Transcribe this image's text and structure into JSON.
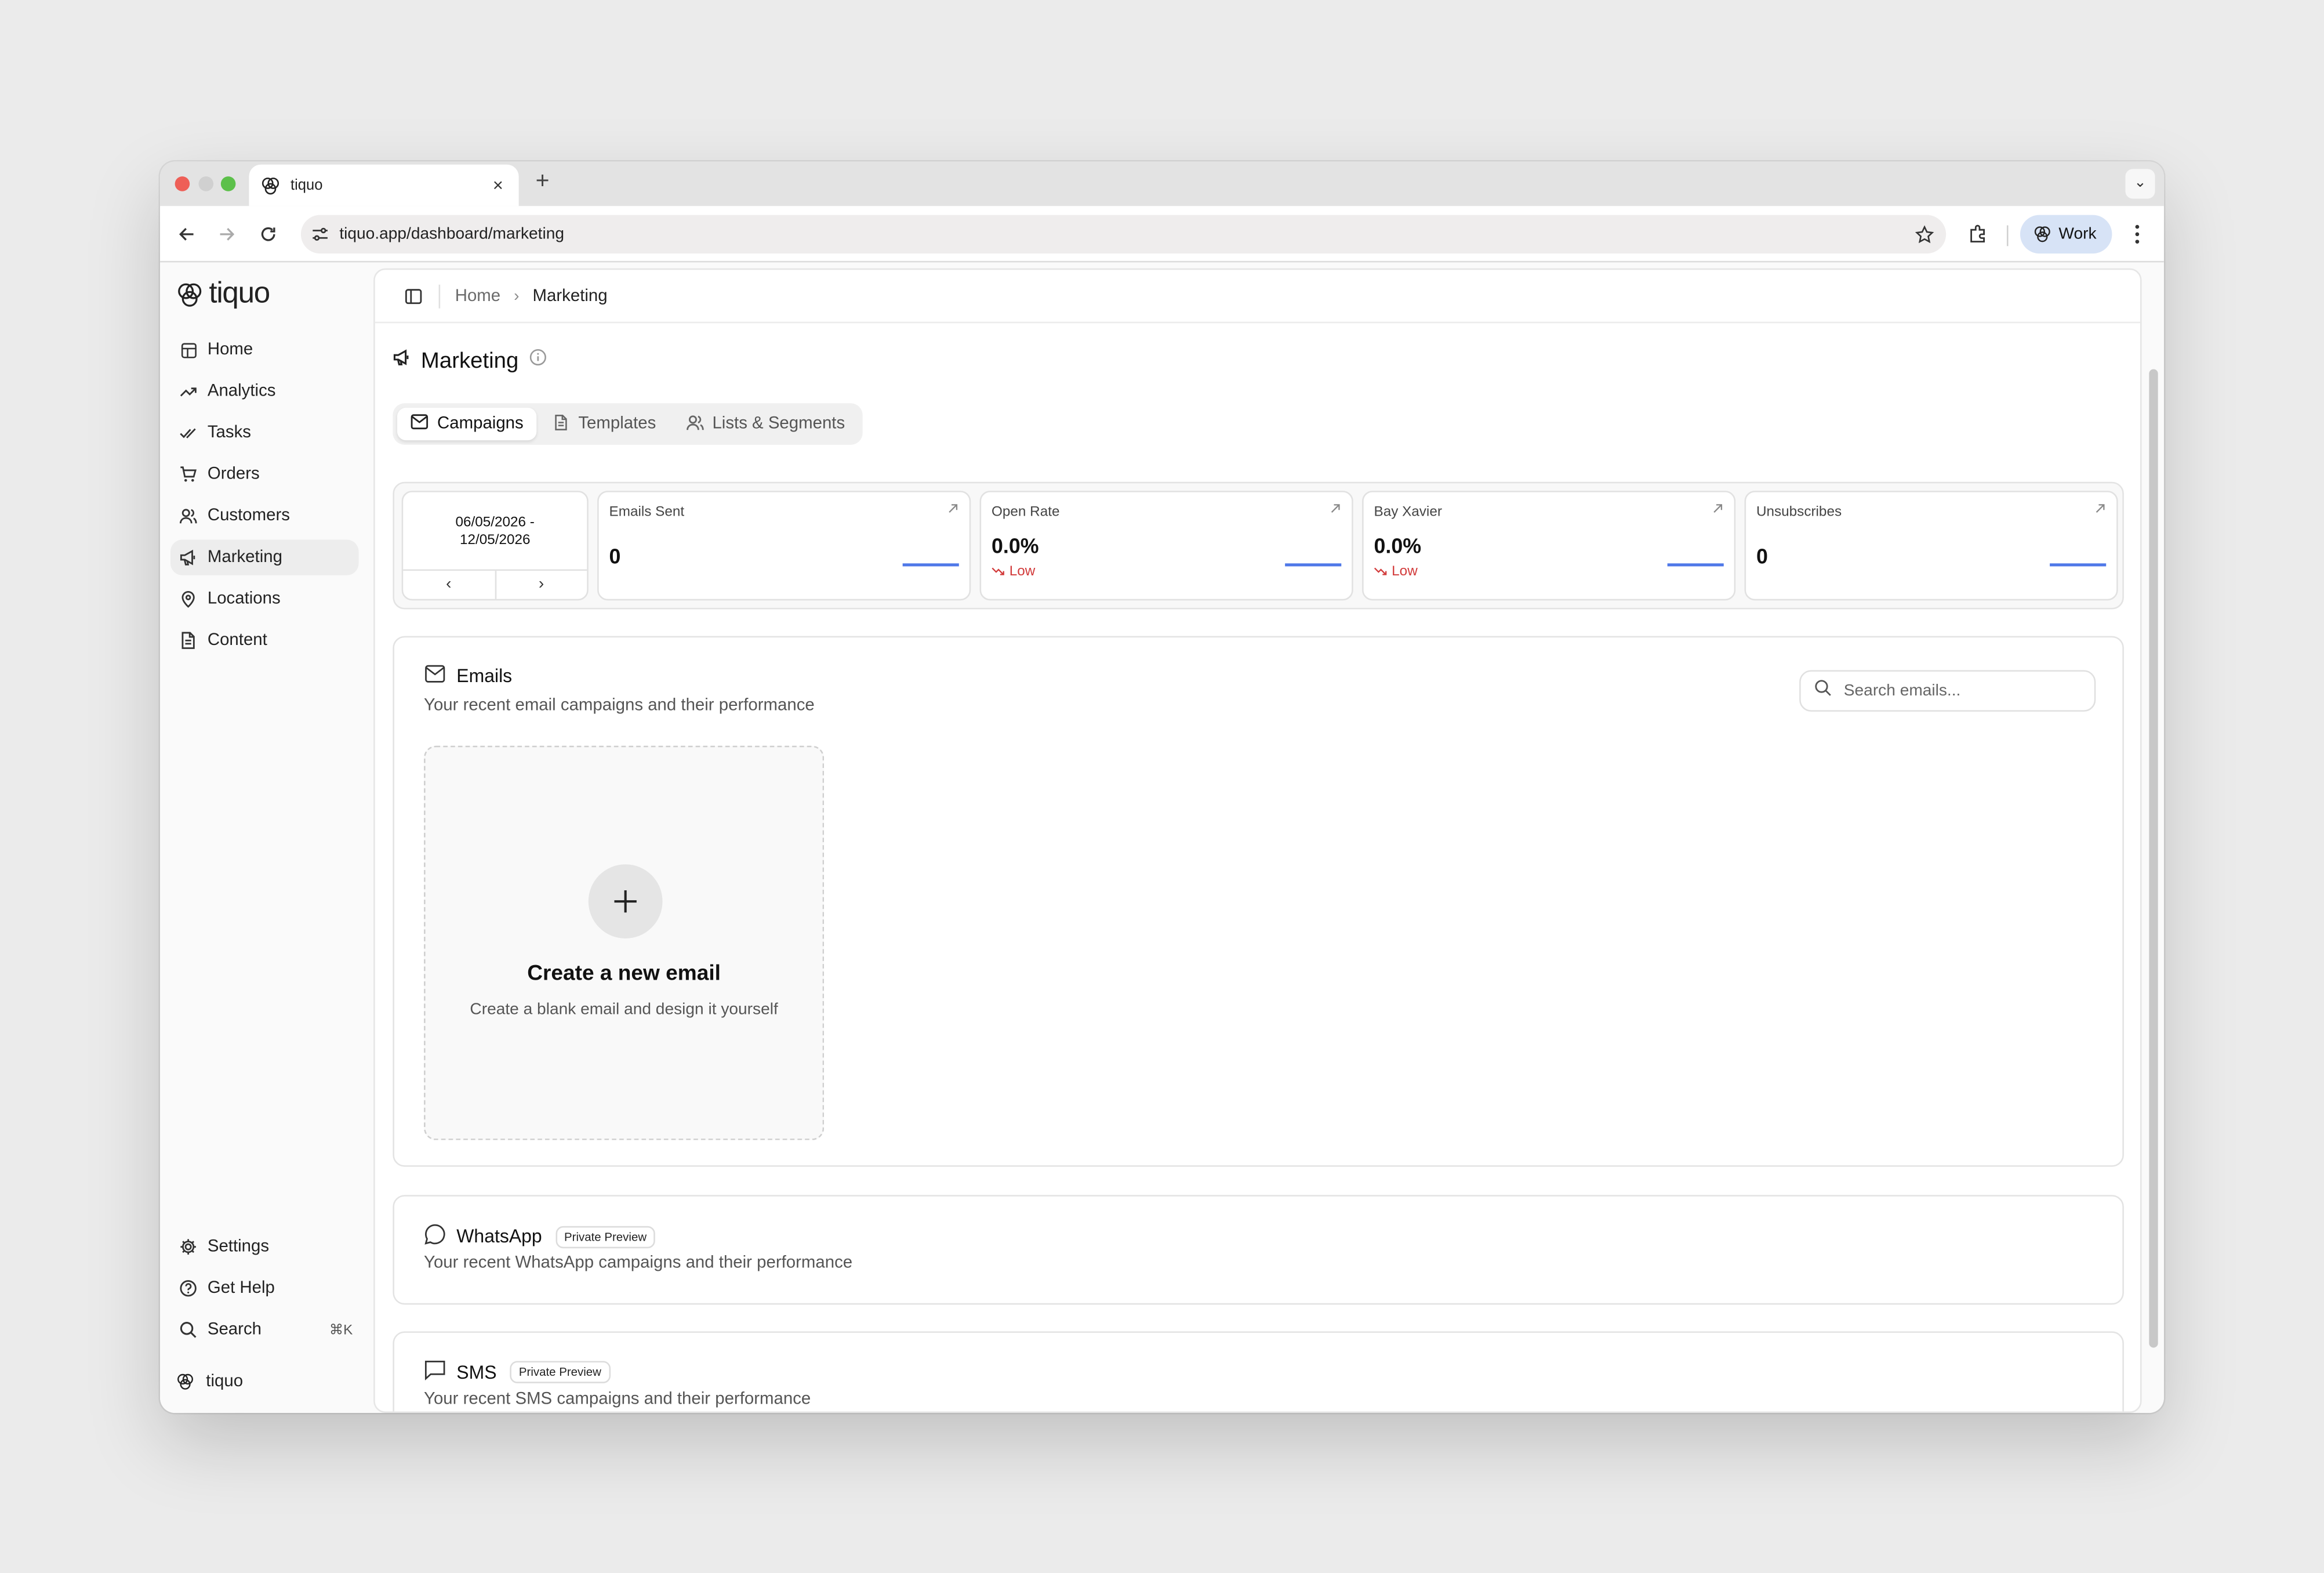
{
  "browser": {
    "tab_title": "tiquo",
    "url": "tiquo.app/dashboard/marketing",
    "profile_label": "Work"
  },
  "brand": {
    "name": "tiquo"
  },
  "sidebar": {
    "items": [
      {
        "label": "Home",
        "icon": "layout-icon"
      },
      {
        "label": "Analytics",
        "icon": "trend-up-icon"
      },
      {
        "label": "Tasks",
        "icon": "check-check-icon"
      },
      {
        "label": "Orders",
        "icon": "cart-icon"
      },
      {
        "label": "Customers",
        "icon": "users-icon"
      },
      {
        "label": "Marketing",
        "icon": "megaphone-icon",
        "active": true
      },
      {
        "label": "Locations",
        "icon": "map-pin-icon"
      },
      {
        "label": "Content",
        "icon": "file-icon"
      }
    ],
    "bottom": [
      {
        "label": "Settings",
        "icon": "gear-icon"
      },
      {
        "label": "Get Help",
        "icon": "help-icon"
      },
      {
        "label": "Search",
        "icon": "search-icon",
        "shortcut": "⌘K"
      }
    ],
    "footer_label": "tiquo"
  },
  "breadcrumb": {
    "home": "Home",
    "current": "Marketing"
  },
  "page": {
    "title": "Marketing"
  },
  "tabs": [
    {
      "label": "Campaigns",
      "icon": "mail-icon",
      "active": true
    },
    {
      "label": "Templates",
      "icon": "file-icon"
    },
    {
      "label": "Lists & Segments",
      "icon": "users-icon"
    }
  ],
  "stats": {
    "date_range": {
      "start": "06/05/2026 -",
      "end": "12/05/2026",
      "prev": "‹",
      "next": "›"
    },
    "cards": [
      {
        "label": "Emails Sent",
        "value": "0",
        "trend": ""
      },
      {
        "label": "Open Rate",
        "value": "0.0%",
        "trend": "Low"
      },
      {
        "label": "Bay Xavier",
        "value": "0.0%",
        "trend": "Low"
      },
      {
        "label": "Unsubscribes",
        "value": "0",
        "trend": ""
      }
    ]
  },
  "emails": {
    "title": "Emails",
    "subtitle": "Your recent email campaigns and their performance",
    "search_placeholder": "Search emails...",
    "create_title": "Create a new email",
    "create_subtitle": "Create a blank email and design it yourself"
  },
  "whatsapp": {
    "title": "WhatsApp",
    "badge": "Private Preview",
    "subtitle": "Your recent WhatsApp campaigns and their performance"
  },
  "sms": {
    "title": "SMS",
    "badge": "Private Preview",
    "subtitle": "Your recent SMS campaigns and their performance"
  },
  "colors": {
    "accent_blue": "#4f78e8",
    "trend_red": "#d23b3b",
    "profile_chip": "#d7e3f6"
  }
}
